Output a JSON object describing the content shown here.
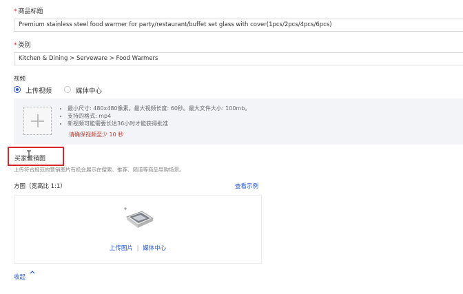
{
  "product_title": {
    "label": "商品标题",
    "value": "Premium stainless steel  food warmer for party/restaurant/buffet set glass with cover(1pcs/2pcs/4pcs/6pcs)"
  },
  "category": {
    "label": "类别",
    "value": "Kitchen & Dining > Serveware > Food Warmers"
  },
  "video": {
    "label": "视频",
    "option_upload": "上传视频",
    "option_media": "媒体中心",
    "selected": "上传视频",
    "requirements": [
      "最小尺寸: 480x480像素。最大视频长度: 60秒。最大文件大小: 100mb。",
      "支持的格式: mp4",
      "新视频可能需要长达36小时才能获得批准"
    ],
    "warning": "请确保视频至少 10 秒"
  },
  "marketing": {
    "title": "买家营销图",
    "description": "上传符合规范的营销图片有机会展示在搜索、推荐、频道等商品导购场景。",
    "square_label": "方图（宽高比 1:1）",
    "view_example": "查看示例",
    "upload_image": "上传图片",
    "separator": "|",
    "media_center": "媒体中心"
  },
  "collapse": {
    "label": "收起",
    "icon": "chevron-up-icon"
  },
  "colors": {
    "accent": "#1f55d6",
    "required": "#e0282e",
    "warning": "#c0392b",
    "highlight_box": "#d9252a"
  }
}
